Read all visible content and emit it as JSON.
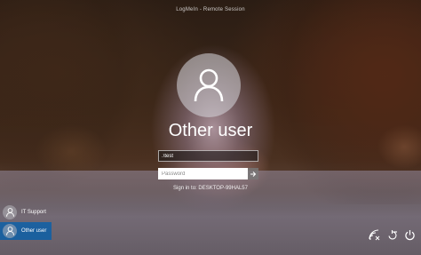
{
  "window": {
    "title": "LogMeIn - Remote Session"
  },
  "login": {
    "username": "Other user",
    "username_field_value": ".\\test",
    "password_placeholder": "Password",
    "signin_to": "Sign in to: DESKTOP-99HAL57"
  },
  "user_list": {
    "items": [
      {
        "label": "IT Support",
        "active": false
      },
      {
        "label": "Other user",
        "active": true
      }
    ]
  },
  "bottom_icons": [
    "network-icon",
    "ease-of-access-icon",
    "power-icon"
  ],
  "colors": {
    "selected_user_bg": "#005faf",
    "password_field_bg": "#ffffff",
    "avatar_circle": "#d7d7dc"
  }
}
